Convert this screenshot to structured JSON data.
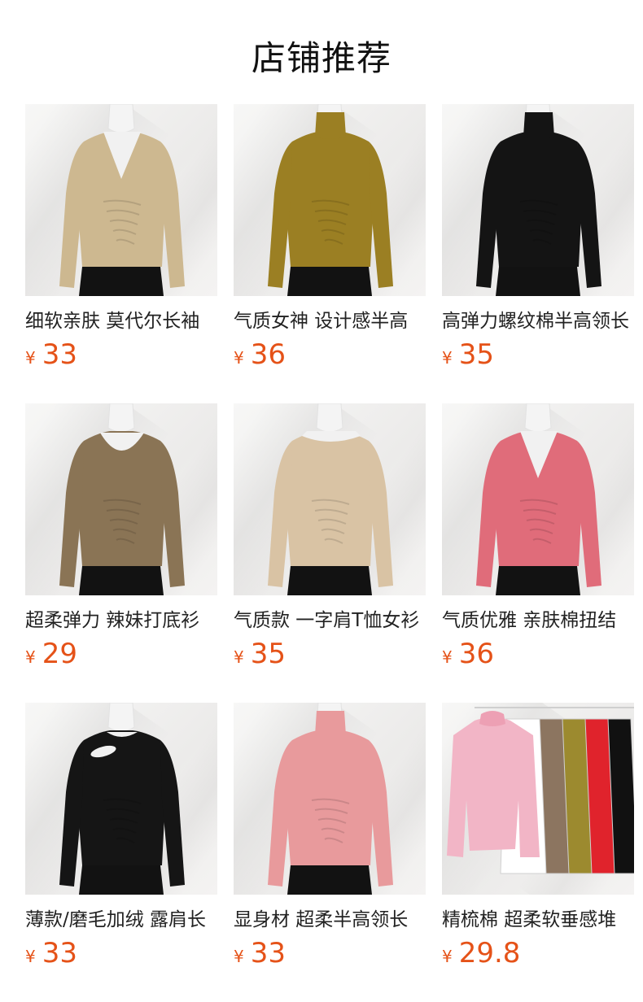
{
  "header": {
    "title": "店铺推荐"
  },
  "currency_symbol": "¥",
  "products": [
    {
      "name": "细软亲肤 莫代尔长袖",
      "price": "33",
      "color": "#cdb890",
      "style": "vneck"
    },
    {
      "name": "气质女神 设计感半高",
      "price": "36",
      "color": "#9b7f23",
      "style": "turtle"
    },
    {
      "name": "高弹力螺纹棉半高领长",
      "price": "35",
      "color": "#141414",
      "style": "turtle"
    },
    {
      "name": "超柔弹力 辣妹打底衫",
      "price": "29",
      "color": "#8a7455",
      "style": "scoop"
    },
    {
      "name": "气质款 一字肩T恤女衫",
      "price": "35",
      "color": "#d9c3a4",
      "style": "boat"
    },
    {
      "name": "气质优雅 亲肤棉扭结",
      "price": "36",
      "color": "#e06c7a",
      "style": "vneck"
    },
    {
      "name": "薄款/磨毛加绒 露肩长",
      "price": "33",
      "color": "#151515",
      "style": "cutout"
    },
    {
      "name": "显身材 超柔半高领长",
      "price": "33",
      "color": "#e89a9c",
      "style": "turtle"
    },
    {
      "name": "精梳棉 超柔软垂感堆",
      "price": "29.8",
      "color": "#f2b5c6",
      "style": "rack",
      "rack_colors": [
        "#111111",
        "#e0232c",
        "#9c8a2f",
        "#8c7560",
        "#ffffff"
      ]
    }
  ]
}
